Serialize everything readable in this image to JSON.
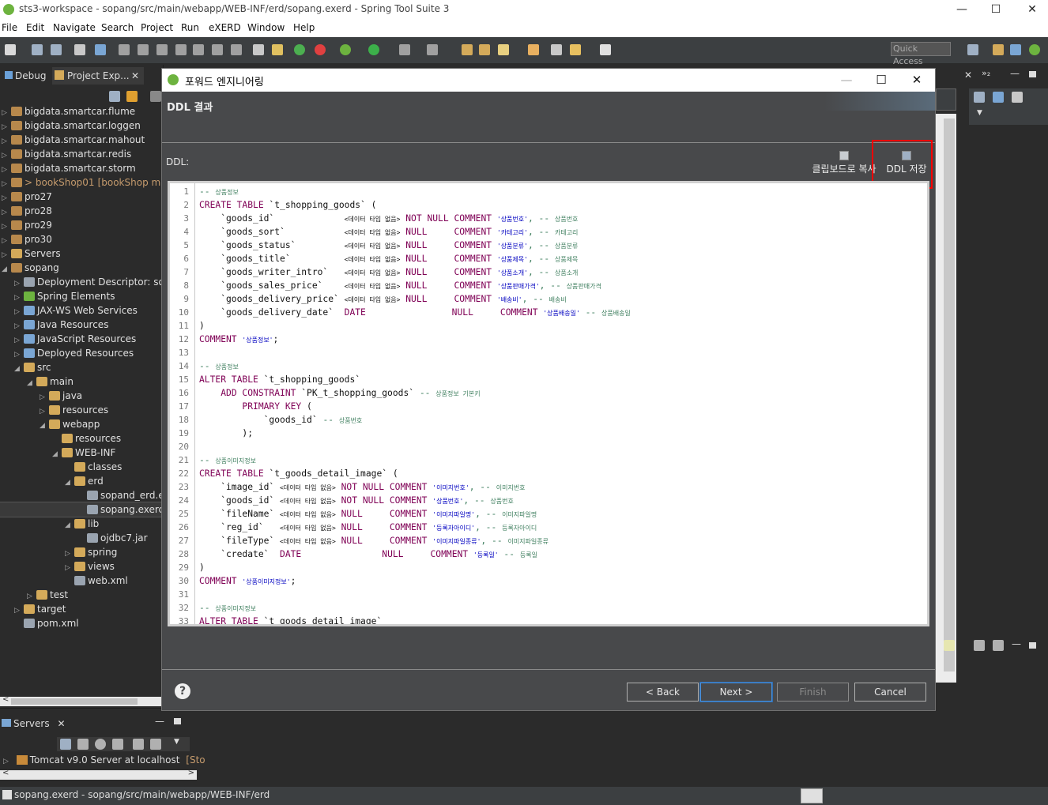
{
  "window": {
    "title": "sts3-workspace - sopang/src/main/webapp/WEB-INF/erd/sopang.exerd - Spring Tool Suite 3",
    "minimize": "—",
    "maximize": "☐",
    "close": "✕"
  },
  "menu": [
    "File",
    "Edit",
    "Navigate",
    "Search",
    "Project",
    "Run",
    "eXERD",
    "Window",
    "Help"
  ],
  "toolbar": {
    "quick_access": "Quick Access"
  },
  "left_panel": {
    "tabs": [
      "Debug",
      "Project Exp..."
    ],
    "tab_close": "✕",
    "tree": [
      {
        "label": "bigdata.smartcar.flume",
        "indent": 0,
        "arrow": "▷",
        "icon": "project"
      },
      {
        "label": "bigdata.smartcar.loggen",
        "indent": 0,
        "arrow": "▷",
        "icon": "project"
      },
      {
        "label": "bigdata.smartcar.mahout",
        "indent": 0,
        "arrow": "▷",
        "icon": "project"
      },
      {
        "label": "bigdata.smartcar.redis",
        "indent": 0,
        "arrow": "▷",
        "icon": "project"
      },
      {
        "label": "bigdata.smartcar.storm",
        "indent": 0,
        "arrow": "▷",
        "icon": "project"
      },
      {
        "label": "> bookShop01",
        "suffix": "[bookShop ma",
        "indent": 0,
        "arrow": "▷",
        "icon": "project"
      },
      {
        "label": "pro27",
        "indent": 0,
        "arrow": "▷",
        "icon": "project"
      },
      {
        "label": "pro28",
        "indent": 0,
        "arrow": "▷",
        "icon": "project"
      },
      {
        "label": "pro29",
        "indent": 0,
        "arrow": "▷",
        "icon": "project"
      },
      {
        "label": "pro30",
        "indent": 0,
        "arrow": "▷",
        "icon": "project"
      },
      {
        "label": "Servers",
        "indent": 0,
        "arrow": "▷",
        "icon": "folder"
      },
      {
        "label": "sopang",
        "indent": 0,
        "arrow": "◢",
        "icon": "project"
      },
      {
        "label": "Deployment Descriptor: sop",
        "indent": 1,
        "arrow": "▷",
        "icon": "file"
      },
      {
        "label": "Spring Elements",
        "indent": 1,
        "arrow": "▷",
        "icon": "spring"
      },
      {
        "label": "JAX-WS Web Services",
        "indent": 1,
        "arrow": "▷",
        "icon": "java"
      },
      {
        "label": "Java Resources",
        "indent": 1,
        "arrow": "▷",
        "icon": "java"
      },
      {
        "label": "JavaScript Resources",
        "indent": 1,
        "arrow": "▷",
        "icon": "java"
      },
      {
        "label": "Deployed Resources",
        "indent": 1,
        "arrow": "▷",
        "icon": "java"
      },
      {
        "label": "src",
        "indent": 1,
        "arrow": "◢",
        "icon": "folder"
      },
      {
        "label": "main",
        "indent": 2,
        "arrow": "◢",
        "icon": "folder"
      },
      {
        "label": "java",
        "indent": 3,
        "arrow": "▷",
        "icon": "folder"
      },
      {
        "label": "resources",
        "indent": 3,
        "arrow": "▷",
        "icon": "folder"
      },
      {
        "label": "webapp",
        "indent": 3,
        "arrow": "◢",
        "icon": "folder"
      },
      {
        "label": "resources",
        "indent": 4,
        "arrow": "",
        "icon": "folder"
      },
      {
        "label": "WEB-INF",
        "indent": 4,
        "arrow": "◢",
        "icon": "folder"
      },
      {
        "label": "classes",
        "indent": 5,
        "arrow": "",
        "icon": "folder"
      },
      {
        "label": "erd",
        "indent": 5,
        "arrow": "◢",
        "icon": "folder"
      },
      {
        "label": "sopand_erd.e",
        "indent": 6,
        "arrow": "",
        "icon": "file"
      },
      {
        "label": "sopang.exerc",
        "indent": 6,
        "arrow": "",
        "icon": "file",
        "selected": true
      },
      {
        "label": "lib",
        "indent": 5,
        "arrow": "◢",
        "icon": "folder"
      },
      {
        "label": "ojdbc7.jar",
        "indent": 6,
        "arrow": "",
        "icon": "file"
      },
      {
        "label": "spring",
        "indent": 5,
        "arrow": "▷",
        "icon": "folder"
      },
      {
        "label": "views",
        "indent": 5,
        "arrow": "▷",
        "icon": "folder"
      },
      {
        "label": "web.xml",
        "indent": 5,
        "arrow": "",
        "icon": "file"
      },
      {
        "label": "test",
        "indent": 2,
        "arrow": "▷",
        "icon": "folder"
      },
      {
        "label": "target",
        "indent": 1,
        "arrow": "▷",
        "icon": "folder"
      },
      {
        "label": "pom.xml",
        "indent": 1,
        "arrow": "",
        "icon": "file"
      }
    ]
  },
  "servers_panel": {
    "tab": "Servers",
    "tab_close": "✕",
    "server": "Tomcat v9.0 Server at localhost",
    "server_state": "[Sto"
  },
  "statusbar": {
    "text": "sopang.exerd - sopang/src/main/webapp/WEB-INF/erd"
  },
  "dialog": {
    "title": "포워드 엔지니어링",
    "minimize": "—",
    "maximize": "☐",
    "close": "✕",
    "header_title": "DDL 결과",
    "ddl_label": "DDL:",
    "copy_clipboard": "클립보드로 복사",
    "save_ddl": "DDL 저장",
    "help": "?",
    "buttons": {
      "back": "< Back",
      "next": "Next >",
      "finish": "Finish",
      "cancel": "Cancel"
    },
    "ddl_lines": [
      [
        [
          "-- ",
          "cmt"
        ],
        [
          "상품정보",
          "cmt small"
        ]
      ],
      [
        [
          "CREATE TABLE",
          "kw"
        ],
        [
          " `t_shopping_goods` (",
          ""
        ]
      ],
      [
        [
          "    `goods_id`             ",
          ""
        ],
        [
          "<데이터 타입 없음>",
          "small"
        ],
        [
          " NOT NULL COMMENT ",
          "kw"
        ],
        [
          "'상품번호'",
          "str small"
        ],
        [
          ", -- ",
          "cmt"
        ],
        [
          "상품번호",
          "cmt small"
        ]
      ],
      [
        [
          "    `goods_sort`           ",
          ""
        ],
        [
          "<데이터 타입 없음>",
          "small"
        ],
        [
          " NULL     COMMENT ",
          "kw"
        ],
        [
          "'카테고리'",
          "str small"
        ],
        [
          ", -- ",
          "cmt"
        ],
        [
          "카테고리",
          "cmt small"
        ]
      ],
      [
        [
          "    `goods_status`         ",
          ""
        ],
        [
          "<데이터 타입 없음>",
          "small"
        ],
        [
          " NULL     COMMENT ",
          "kw"
        ],
        [
          "'상품분류'",
          "str small"
        ],
        [
          ", -- ",
          "cmt"
        ],
        [
          "상품분류",
          "cmt small"
        ]
      ],
      [
        [
          "    `goods_title`          ",
          ""
        ],
        [
          "<데이터 타입 없음>",
          "small"
        ],
        [
          " NULL     COMMENT ",
          "kw"
        ],
        [
          "'상품제목'",
          "str small"
        ],
        [
          ", -- ",
          "cmt"
        ],
        [
          "상품제목",
          "cmt small"
        ]
      ],
      [
        [
          "    `goods_writer_intro`   ",
          ""
        ],
        [
          "<데이터 타입 없음>",
          "small"
        ],
        [
          " NULL     COMMENT ",
          "kw"
        ],
        [
          "'상품소개'",
          "str small"
        ],
        [
          ", -- ",
          "cmt"
        ],
        [
          "상품소개",
          "cmt small"
        ]
      ],
      [
        [
          "    `goods_sales_price`    ",
          ""
        ],
        [
          "<데이터 타입 없음>",
          "small"
        ],
        [
          " NULL     COMMENT ",
          "kw"
        ],
        [
          "'상품판매가격'",
          "str small"
        ],
        [
          ", -- ",
          "cmt"
        ],
        [
          "상품판매가격",
          "cmt small"
        ]
      ],
      [
        [
          "    `goods_delivery_price` ",
          ""
        ],
        [
          "<데이터 타입 없음>",
          "small"
        ],
        [
          " NULL     COMMENT ",
          "kw"
        ],
        [
          "'배송비'",
          "str small"
        ],
        [
          ", -- ",
          "cmt"
        ],
        [
          "배송비",
          "cmt small"
        ]
      ],
      [
        [
          "    `goods_delivery_date`  ",
          ""
        ],
        [
          "DATE",
          "kw"
        ],
        [
          "                NULL     ",
          "kw"
        ],
        [
          "COMMENT ",
          "kw"
        ],
        [
          "'상품배송일'",
          "str small"
        ],
        [
          " -- ",
          "cmt"
        ],
        [
          "상품배송일",
          "cmt small"
        ]
      ],
      [
        [
          ")",
          ""
        ]
      ],
      [
        [
          "COMMENT ",
          "kw"
        ],
        [
          "'상품정보'",
          "str small"
        ],
        [
          ";",
          ""
        ]
      ],
      [
        [
          "",
          ""
        ]
      ],
      [
        [
          "-- ",
          "cmt"
        ],
        [
          "상품정보",
          "cmt small"
        ]
      ],
      [
        [
          "ALTER TABLE",
          "kw"
        ],
        [
          " `t_shopping_goods`",
          ""
        ]
      ],
      [
        [
          "    ",
          ""
        ],
        [
          "ADD CONSTRAINT",
          "kw"
        ],
        [
          " `PK_t_shopping_goods` ",
          ""
        ],
        [
          "-- ",
          "cmt"
        ],
        [
          "상품정보 기본키",
          "cmt small"
        ]
      ],
      [
        [
          "        ",
          ""
        ],
        [
          "PRIMARY KEY",
          "kw"
        ],
        [
          " (",
          ""
        ]
      ],
      [
        [
          "            `goods_id` ",
          ""
        ],
        [
          "-- ",
          "cmt"
        ],
        [
          "상품번호",
          "cmt small"
        ]
      ],
      [
        [
          "        );",
          ""
        ]
      ],
      [
        [
          "",
          ""
        ]
      ],
      [
        [
          "-- ",
          "cmt"
        ],
        [
          "상품이미지정보",
          "cmt small"
        ]
      ],
      [
        [
          "CREATE TABLE",
          "kw"
        ],
        [
          " `t_goods_detail_image` (",
          ""
        ]
      ],
      [
        [
          "    `image_id` ",
          ""
        ],
        [
          "<데이터 타입 없음>",
          "small"
        ],
        [
          " NOT NULL COMMENT ",
          "kw"
        ],
        [
          "'이미지번호'",
          "str small"
        ],
        [
          ", -- ",
          "cmt"
        ],
        [
          "이미지번호",
          "cmt small"
        ]
      ],
      [
        [
          "    `goods_id` ",
          ""
        ],
        [
          "<데이터 타입 없음>",
          "small"
        ],
        [
          " NOT NULL COMMENT ",
          "kw"
        ],
        [
          "'상품번호'",
          "str small"
        ],
        [
          ", -- ",
          "cmt"
        ],
        [
          "상품번호",
          "cmt small"
        ]
      ],
      [
        [
          "    `fileName` ",
          ""
        ],
        [
          "<데이터 타입 없음>",
          "small"
        ],
        [
          " NULL     COMMENT ",
          "kw"
        ],
        [
          "'이미지파일명'",
          "str small"
        ],
        [
          ", -- ",
          "cmt"
        ],
        [
          "이미지파일명",
          "cmt small"
        ]
      ],
      [
        [
          "    `reg_id`   ",
          ""
        ],
        [
          "<데이터 타입 없음>",
          "small"
        ],
        [
          " NULL     COMMENT ",
          "kw"
        ],
        [
          "'등록자아이디'",
          "str small"
        ],
        [
          ", -- ",
          "cmt"
        ],
        [
          "등록자아이디",
          "cmt small"
        ]
      ],
      [
        [
          "    `fileType` ",
          ""
        ],
        [
          "<데이터 타입 없음>",
          "small"
        ],
        [
          " NULL     COMMENT ",
          "kw"
        ],
        [
          "'이미지파일종류'",
          "str small"
        ],
        [
          ", -- ",
          "cmt"
        ],
        [
          "이미지파일종류",
          "cmt small"
        ]
      ],
      [
        [
          "    `credate`  ",
          ""
        ],
        [
          "DATE",
          "kw"
        ],
        [
          "               NULL     ",
          "kw"
        ],
        [
          "COMMENT ",
          "kw"
        ],
        [
          "'등록일'",
          "str small"
        ],
        [
          " -- ",
          "cmt"
        ],
        [
          "등록일",
          "cmt small"
        ]
      ],
      [
        [
          ")",
          ""
        ]
      ],
      [
        [
          "COMMENT ",
          "kw"
        ],
        [
          "'상품이미지정보'",
          "str small"
        ],
        [
          ";",
          ""
        ]
      ],
      [
        [
          "",
          ""
        ]
      ],
      [
        [
          "-- ",
          "cmt"
        ],
        [
          "상품이미지정보",
          "cmt small"
        ]
      ],
      [
        [
          "ALTER TABLE",
          "kw"
        ],
        [
          " `t_goods_detail_image`",
          ""
        ]
      ]
    ]
  }
}
